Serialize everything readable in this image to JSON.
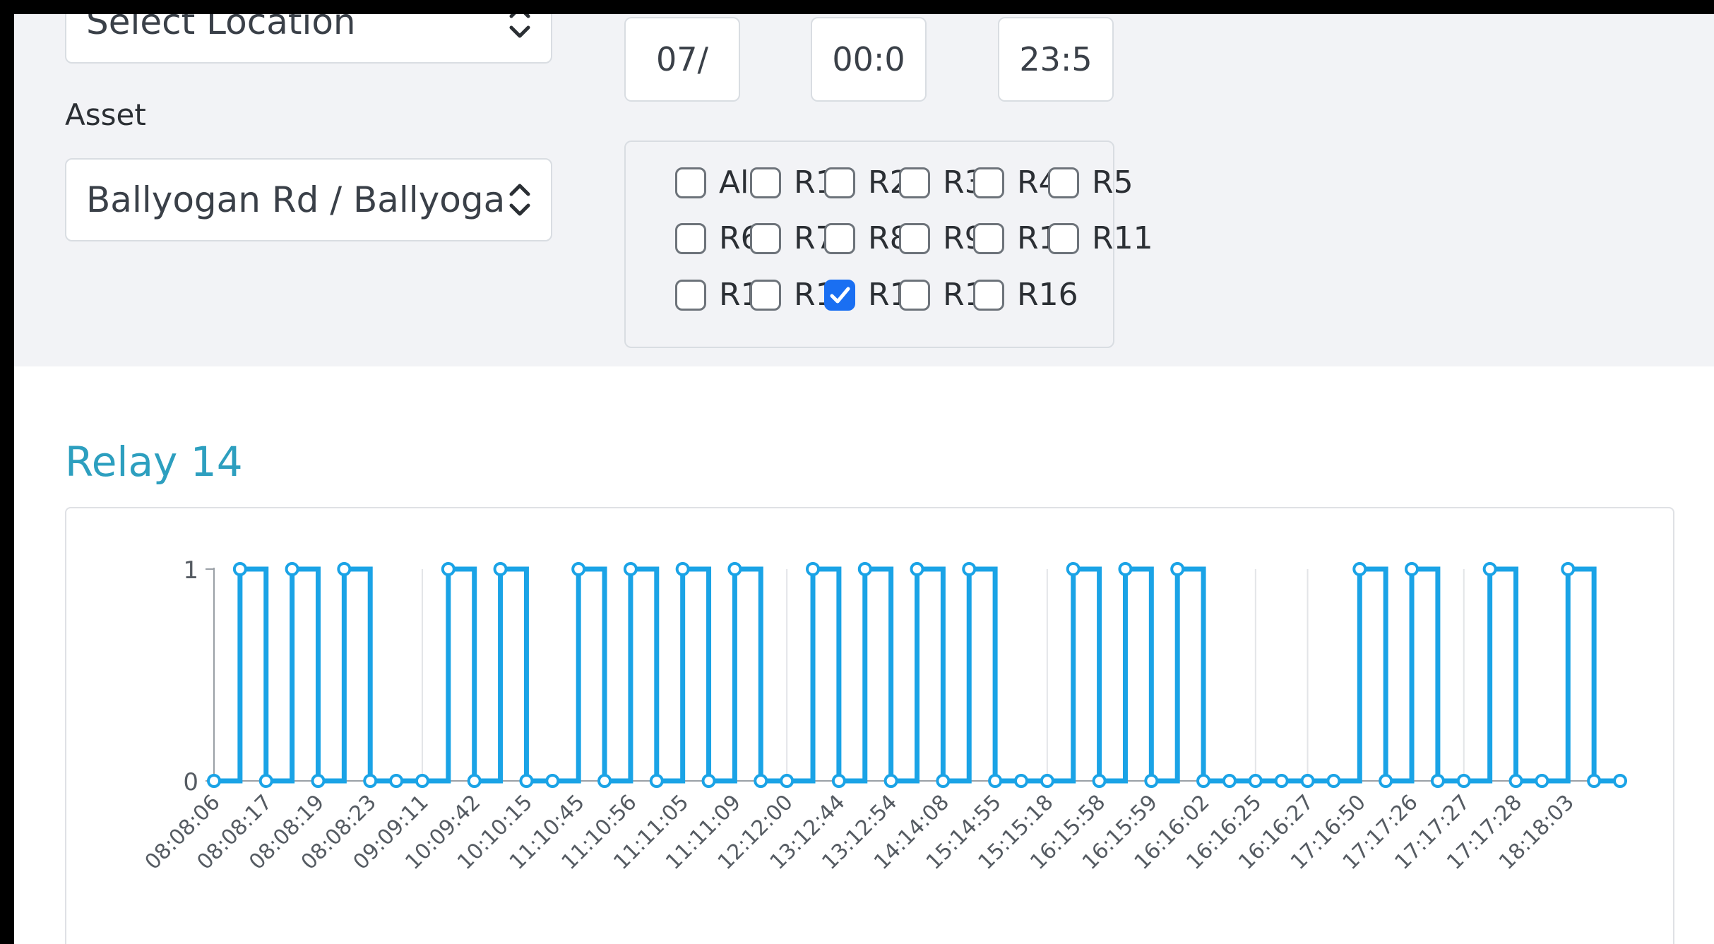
{
  "filters": {
    "location_placeholder": "Select Location",
    "asset_label": "Asset",
    "asset_value": "Ballyogan Rd / Ballyogan",
    "date_value": "07/",
    "time_start_value": "00:0",
    "time_end_value": "23:5"
  },
  "relays": [
    {
      "label": "All",
      "checked": false
    },
    {
      "label": "R1",
      "checked": false
    },
    {
      "label": "R2",
      "checked": false
    },
    {
      "label": "R3",
      "checked": false
    },
    {
      "label": "R4",
      "checked": false
    },
    {
      "label": "R5",
      "checked": false
    },
    {
      "label": "R6",
      "checked": false
    },
    {
      "label": "R7",
      "checked": false
    },
    {
      "label": "R8",
      "checked": false
    },
    {
      "label": "R9",
      "checked": false
    },
    {
      "label": "R10",
      "checked": false
    },
    {
      "label": "R11",
      "checked": false
    },
    {
      "label": "R12",
      "checked": false
    },
    {
      "label": "R13",
      "checked": false
    },
    {
      "label": "R14",
      "checked": true
    },
    {
      "label": "R15",
      "checked": false
    },
    {
      "label": "R16",
      "checked": false
    }
  ],
  "chart": {
    "title": "Relay 14"
  },
  "colors": {
    "accent": "#2d9fbf",
    "series": "#1aa3e6",
    "checkbox_checked": "#1a6ff2"
  },
  "chart_data": {
    "type": "line",
    "step": "after",
    "title": "Relay 14",
    "xlabel": "",
    "ylabel": "",
    "ylim": [
      0,
      1
    ],
    "yticks": [
      0,
      1
    ],
    "xticklabels": [
      "08:08:06",
      "08:08:17",
      "08:08:19",
      "08:08:23",
      "09:09:11",
      "10:09:42",
      "10:10:15",
      "11:10:45",
      "11:10:56",
      "11:11:05",
      "11:11:09",
      "12:12:00",
      "13:12:44",
      "13:12:54",
      "14:14:08",
      "15:14:55",
      "15:15:18",
      "16:15:58",
      "16:15:59",
      "16:16:02",
      "16:16:25",
      "16:16:27",
      "17:16:50",
      "17:17:26",
      "17:17:27",
      "17:17:28",
      "18:18:03"
    ],
    "values": [
      0,
      1,
      0,
      1,
      0,
      1,
      0,
      0,
      0,
      1,
      0,
      1,
      0,
      0,
      1,
      0,
      1,
      0,
      1,
      0,
      1,
      0,
      0,
      1,
      0,
      1,
      0,
      1,
      0,
      1,
      0,
      0,
      0,
      1,
      0,
      1,
      0,
      1,
      0,
      0,
      0,
      0,
      0,
      0,
      1,
      0,
      1,
      0,
      0,
      1,
      0,
      0,
      1,
      0,
      0
    ]
  }
}
